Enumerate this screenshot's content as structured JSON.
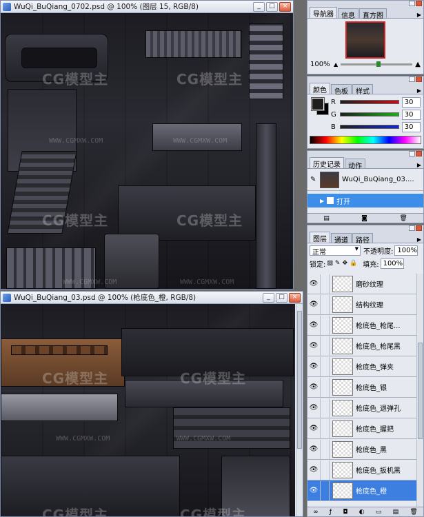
{
  "doc1": {
    "title": "WuQi_BuQiang_0702.psd @ 100% (图层 15, RGB/8)"
  },
  "doc2": {
    "title": "WuQi_BuQiang_03.psd @ 100% (枪底色_橙, RGB/8)"
  },
  "watermark": {
    "logo_text": "CG模型主",
    "url_text": "WWW.CGMXW.COM"
  },
  "window_buttons": {
    "minimize": "_",
    "maximize": "□",
    "close": "×"
  },
  "navigator": {
    "tabs": [
      "导航器",
      "信息",
      "直方图"
    ],
    "zoom": "100%"
  },
  "color": {
    "tabs": [
      "颜色",
      "色板",
      "样式"
    ],
    "channels": [
      {
        "label": "R",
        "value": "30",
        "bar_color": "#c8101a"
      },
      {
        "label": "G",
        "value": "30",
        "bar_color": "#18b018"
      },
      {
        "label": "B",
        "value": "30",
        "bar_color": "#1828c8"
      }
    ]
  },
  "history": {
    "tabs": [
      "历史记录",
      "动作"
    ],
    "snapshot_name": "WuQi_BuQiang_03....",
    "states": [
      "打开"
    ]
  },
  "layers": {
    "tabs": [
      "图层",
      "通道",
      "路径"
    ],
    "blend_mode": "正常",
    "opacity_label": "不透明度:",
    "opacity_value": "100%",
    "lock_label": "锁定:",
    "fill_label": "填充:",
    "fill_value": "100%",
    "items": [
      {
        "name": "磨砂纹理",
        "active": false
      },
      {
        "name": "结构纹理",
        "active": false
      },
      {
        "name": "枪底色_枪尾...",
        "active": false
      },
      {
        "name": "枪底色_枪尾黑",
        "active": false
      },
      {
        "name": "枪底色_弹夹",
        "active": false
      },
      {
        "name": "枪底色_银",
        "active": false
      },
      {
        "name": "枪底色_退弹孔",
        "active": false
      },
      {
        "name": "枪底色_握把",
        "active": false
      },
      {
        "name": "枪底色_黑",
        "active": false
      },
      {
        "name": "枪底色_扳机黑",
        "active": false
      },
      {
        "name": "枪底色_橙",
        "active": true
      }
    ]
  },
  "icons": {
    "eye": "👁",
    "arrow": "▶",
    "dropdown": "▼"
  }
}
